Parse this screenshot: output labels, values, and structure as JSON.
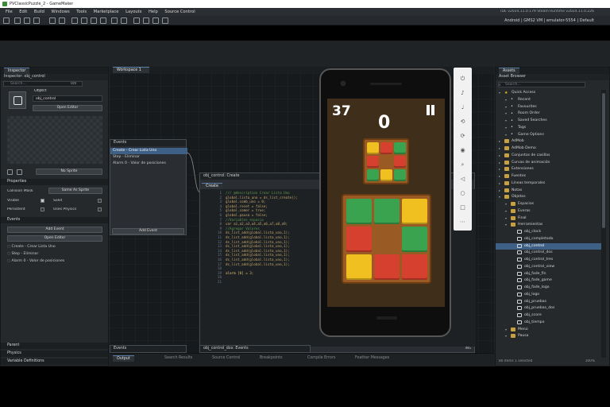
{
  "titlebar": {
    "title": "PVClassicPuzzle_2 - GameMaker"
  },
  "menu": [
    "File",
    "Edit",
    "Build",
    "Windows",
    "Tools",
    "Marketplace",
    "Layouts",
    "Help",
    "Source Control"
  ],
  "ide_info": "IDE v2024.11.0.179 Steam  Runtime v2024.11.0.226",
  "target_line": "Android  |  GMS2 VM  |  emulator-5554  |  Default",
  "inspector": {
    "tab": "Inspector",
    "title": "Inspector: obj_control",
    "search_placeholder": "Search...",
    "count": "0/0",
    "object_label": "Object",
    "object_name": "obj_control",
    "open_editor": "Open Editor",
    "no_sprite": "No Sprite",
    "properties": "Properties",
    "collision_mask": "Collision Mask",
    "same_as_sprite": "Same As Sprite",
    "visible": "Visible",
    "solid": "Solid",
    "persistent": "Persistent",
    "uses_physics": "Uses Physics",
    "events_section": "Events",
    "add_event": "Add Event",
    "open_editor2": "Open Editor",
    "events": [
      "Create - Crear Lista Uno",
      "Step - Eliminar",
      "Alarm 0 - Valor de posiciones"
    ],
    "parent": "Parent",
    "physics": "Physics",
    "variable_definitions": "Variable Definitions"
  },
  "workspace": {
    "tab": "Workspace 1"
  },
  "events_window": {
    "title": "Events",
    "items": [
      "Create - Crear Lista Uno",
      "Step - Eliminar",
      "Alarm 0 - Valor de posiciones"
    ],
    "add_event": "Add Event"
  },
  "code_window": {
    "title": "obj_control: Create",
    "tab": "Create",
    "lines": [
      "/// @description Crear Lista Uno",
      "global.lista_uno = ds_list_create();",
      "global.comb_uno = 0;",
      "global.reset = false;",
      "global.comer = true;",
      "global.pausa = false;",
      "//Variables espacio",
      "var a1,a2,a3,a4,a5,a6,a7,a8,a9;",
      "//Agregar Valores",
      "ds_list_add(global.lista_uno,1);",
      "ds_list_add(global.lista_uno,1);",
      "ds_list_add(global.lista_uno,1);",
      "ds_list_add(global.lista_uno,1);",
      "ds_list_add(global.lista_uno,1);",
      "ds_list_add(global.lista_uno,1);",
      "ds_list_add(global.lista_uno,1);",
      "ds_list_add(global.lista_uno,1);",
      "",
      "alarm [0] = 3;",
      "",
      ""
    ],
    "status": "INS"
  },
  "events_bottom": {
    "title": "Events"
  },
  "code_bottom": {
    "title": "obj_control_dos: Events"
  },
  "bottom_tabs": [
    "Output",
    "Search Results",
    "Source Control",
    "Breakpoints",
    "Compile Errors",
    "Feather Messages"
  ],
  "game": {
    "left_number": "37",
    "center_number": "0",
    "pause_icon": "pause-icon"
  },
  "assets": {
    "tab": "Assets",
    "title": "Asset Browser",
    "search_placeholder": "Search...",
    "tree": [
      {
        "label": "Quick Access",
        "indent": 0,
        "icon": "star-icon"
      },
      {
        "label": "Recent",
        "indent": 1,
        "icon": "clock-icon"
      },
      {
        "label": "Favourites",
        "indent": 1,
        "icon": "heart-icon"
      },
      {
        "label": "Room Order",
        "indent": 1,
        "icon": "list-icon"
      },
      {
        "label": "Saved Searches",
        "indent": 1,
        "icon": "search-icon"
      },
      {
        "label": "Tags",
        "indent": 1,
        "icon": "tag-icon"
      },
      {
        "label": "Game Options",
        "indent": 1,
        "icon": "gear-icon"
      },
      {
        "label": "AdMob",
        "indent": 0,
        "icon": "folder-icon"
      },
      {
        "label": "AdMob Demo",
        "indent": 0,
        "icon": "folder-icon"
      },
      {
        "label": "Conjuntos de casillas",
        "indent": 0,
        "icon": "folder-icon"
      },
      {
        "label": "Curvas de animación",
        "indent": 0,
        "icon": "folder-icon"
      },
      {
        "label": "Extensiones",
        "indent": 0,
        "icon": "folder-icon"
      },
      {
        "label": "Fuentes",
        "indent": 0,
        "icon": "folder-icon"
      },
      {
        "label": "Líneas temporales",
        "indent": 0,
        "icon": "folder-icon"
      },
      {
        "label": "Notas",
        "indent": 0,
        "icon": "folder-icon"
      },
      {
        "label": "Objetos",
        "indent": 0,
        "icon": "folder-icon"
      },
      {
        "label": "Espacios",
        "indent": 1,
        "icon": "folder-icon"
      },
      {
        "label": "Everas",
        "indent": 1,
        "icon": "folder-icon"
      },
      {
        "label": "Final",
        "indent": 1,
        "icon": "folder-icon"
      },
      {
        "label": "Herramientas",
        "indent": 1,
        "icon": "folder-icon"
      },
      {
        "label": "obj_clock",
        "indent": 2,
        "icon": "object-icon"
      },
      {
        "label": "obj_completado",
        "indent": 2,
        "icon": "object-icon"
      },
      {
        "label": "obj_control",
        "indent": 2,
        "icon": "object-icon",
        "selected": true
      },
      {
        "label": "obj_control_dos",
        "indent": 2,
        "icon": "object-icon"
      },
      {
        "label": "obj_control_tres",
        "indent": 2,
        "icon": "object-icon"
      },
      {
        "label": "obj_control_view",
        "indent": 2,
        "icon": "object-icon"
      },
      {
        "label": "obj_fade_fin",
        "indent": 2,
        "icon": "object-icon"
      },
      {
        "label": "obj_fade_game",
        "indent": 2,
        "icon": "object-icon"
      },
      {
        "label": "obj_fade_logo",
        "indent": 2,
        "icon": "object-icon"
      },
      {
        "label": "obj_logo",
        "indent": 2,
        "icon": "object-icon"
      },
      {
        "label": "obj_pruebas",
        "indent": 2,
        "icon": "object-icon"
      },
      {
        "label": "obj_pruebas_dos",
        "indent": 2,
        "icon": "object-icon"
      },
      {
        "label": "obj_score",
        "indent": 2,
        "icon": "object-icon"
      },
      {
        "label": "obj_tiempo",
        "indent": 2,
        "icon": "object-icon"
      },
      {
        "label": "Menú",
        "indent": 1,
        "icon": "folder-icon"
      },
      {
        "label": "Pausa",
        "indent": 1,
        "icon": "folder-icon"
      }
    ],
    "footer": "80 items  1 selected",
    "zoom": "100%"
  },
  "colors": {
    "accent": "#5b7fa6",
    "tile_green": "#3aa34f",
    "tile_red": "#d6402e",
    "tile_yellow": "#f0c020",
    "board_frame": "#9a5a24",
    "game_bg": "#3e2e1a"
  }
}
